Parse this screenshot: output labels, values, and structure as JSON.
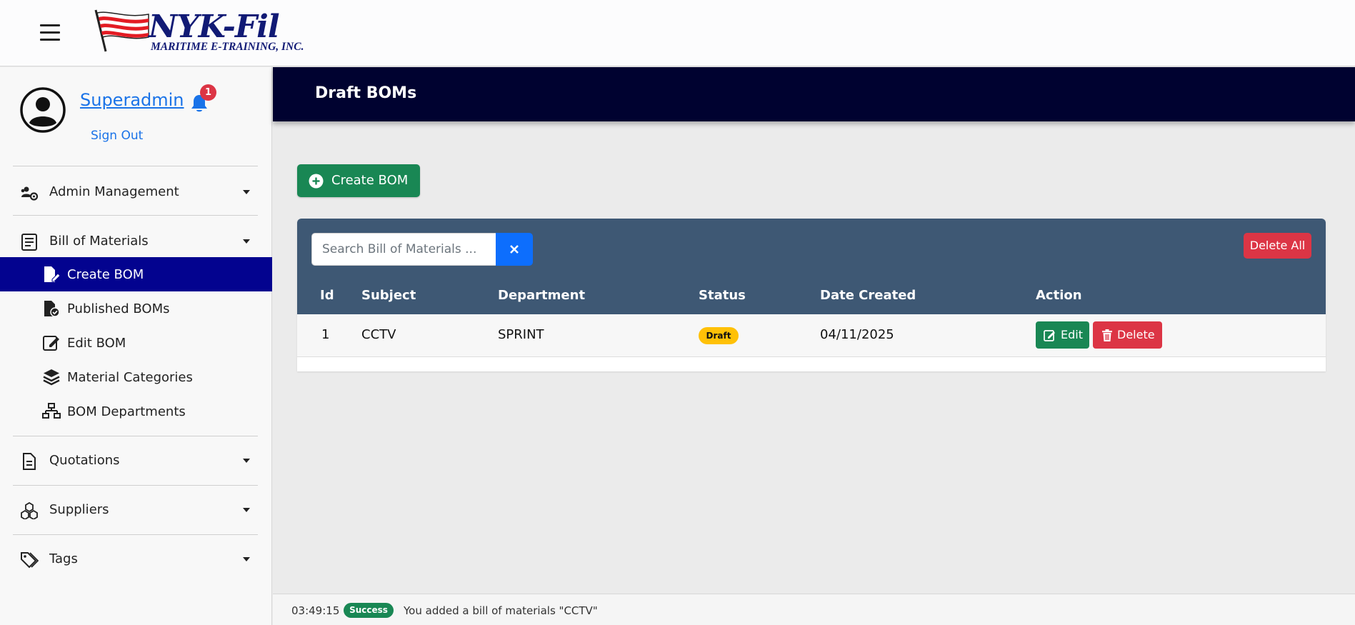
{
  "brand": {
    "logo_text": "NYK-Fil",
    "tagline": "MARITIME E-TRAINING, INC."
  },
  "user": {
    "name": "Superadmin",
    "notification_count": "1",
    "sign_out": "Sign Out"
  },
  "sidebar": {
    "items": [
      {
        "label": "Admin Management",
        "icon": "users-gear-icon"
      },
      {
        "label": "Bill of Materials",
        "icon": "receipt-icon"
      },
      {
        "label": "Quotations",
        "icon": "document-icon"
      },
      {
        "label": "Suppliers",
        "icon": "boxes-icon"
      },
      {
        "label": "Tags",
        "icon": "tags-icon"
      }
    ],
    "bom_submenu": [
      {
        "label": "Create BOM",
        "icon": "file-pen-icon",
        "active": true
      },
      {
        "label": "Published BOMs",
        "icon": "file-check-icon"
      },
      {
        "label": "Edit BOM",
        "icon": "edit-icon"
      },
      {
        "label": "Material Categories",
        "icon": "layers-icon"
      },
      {
        "label": "BOM Departments",
        "icon": "sitemap-icon"
      }
    ]
  },
  "header": {
    "title": "Draft BOMs"
  },
  "toolbar": {
    "create_label": "Create BOM",
    "search_placeholder": "Search Bill of Materials ...",
    "delete_all_label": "Delete All"
  },
  "table": {
    "columns": [
      "Id",
      "Subject",
      "Department",
      "Status",
      "Date Created",
      "Action"
    ],
    "rows": [
      {
        "id": "1",
        "subject": "CCTV",
        "department": "SPRINT",
        "status": "Draft",
        "date_created": "04/11/2025",
        "edit_label": "Edit",
        "delete_label": "Delete"
      }
    ]
  },
  "status_bar": {
    "time": "03:49:15",
    "badge": "Success",
    "message": "You added a bill of materials \"CCTV\""
  },
  "colors": {
    "header_bg": "#000230",
    "active_nav": "#03038f",
    "table_header": "#3e5874",
    "success": "#198754",
    "danger": "#dc3545",
    "primary": "#0d6efd",
    "warning": "#ffc107",
    "link": "#1a73e8"
  }
}
